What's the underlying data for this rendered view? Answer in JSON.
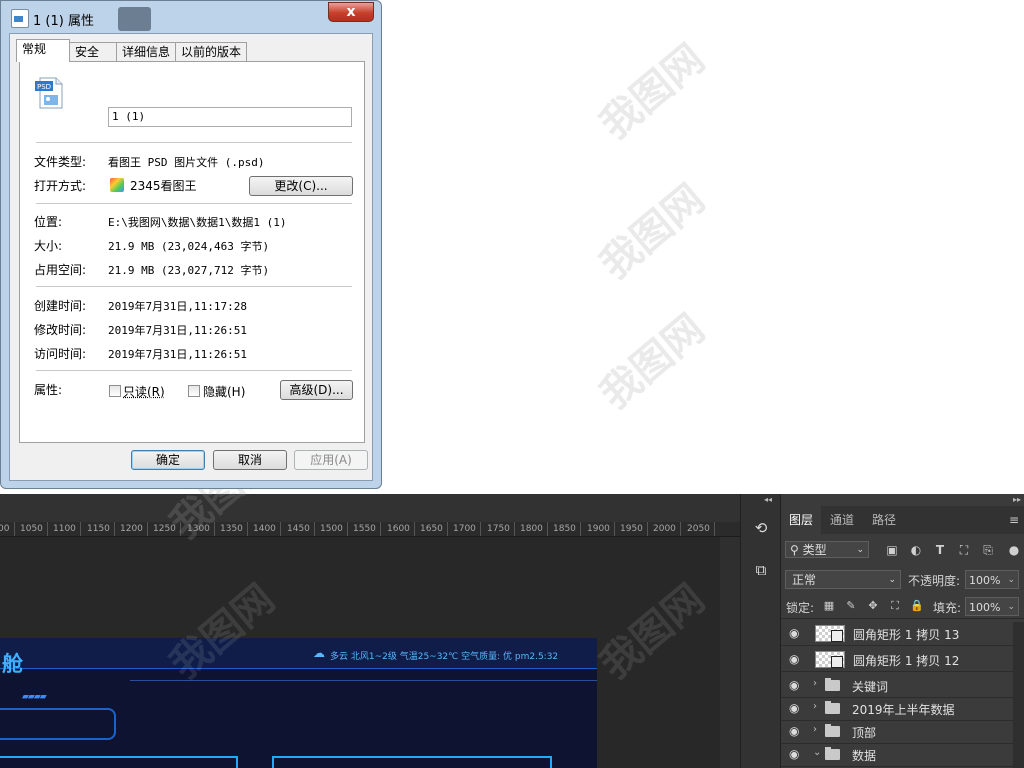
{
  "dialog": {
    "title": "1 (1) 属性",
    "close_label": "x",
    "tabs": [
      "常规",
      "安全",
      "详细信息",
      "以前的版本"
    ],
    "file_name": "1 (1)",
    "psd_badge": "PSD",
    "file_type_label": "文件类型:",
    "file_type_value": "看图王 PSD 图片文件 (.psd)",
    "open_with_label": "打开方式:",
    "open_with_value": "2345看图王",
    "change_button": "更改(C)...",
    "location_label": "位置:",
    "location_value": "E:\\我图网\\数据\\数据1\\数据1 (1)",
    "size_label": "大小:",
    "size_value": "21.9 MB (23,024,463 字节)",
    "disk_size_label": "占用空间:",
    "disk_size_value": "21.9 MB (23,027,712 字节)",
    "created_label": "创建时间:",
    "created_value": "2019年7月31日,11:17:28",
    "modified_label": "修改时间:",
    "modified_value": "2019年7月31日,11:26:51",
    "accessed_label": "访问时间:",
    "accessed_value": "2019年7月31日,11:26:51",
    "attributes_label": "属性:",
    "readonly_label": "只读(R)",
    "hidden_label": "隐藏(H)",
    "advanced_button": "高级(D)...",
    "ok_button": "确定",
    "cancel_button": "取消",
    "apply_button": "应用(A)"
  },
  "photoshop": {
    "ruler_labels": [
      "00",
      "1050",
      "1100",
      "1150",
      "1200",
      "1250",
      "1300",
      "1350",
      "1400",
      "1450",
      "1500",
      "1550",
      "1600",
      "1650",
      "1700",
      "1750",
      "1800",
      "1850",
      "1900",
      "1950",
      "2000",
      "2050"
    ],
    "artwork": {
      "title": "舱",
      "weather": "多云  北风1~2级  气温25~32℃  空气质量: 优  pm2.5:32",
      "stripes": "▰▰▰▰"
    },
    "layers_panel": {
      "tabs": [
        "图层",
        "通道",
        "路径"
      ],
      "kind_filter": "类型",
      "blend_mode": "正常",
      "opacity_label": "不透明度:",
      "opacity_value": "100%",
      "lock_label": "锁定:",
      "fill_label": "填充:",
      "fill_value": "100%",
      "layers": [
        {
          "name": "圆角矩形 1 拷贝 13",
          "type": "shape"
        },
        {
          "name": "圆角矩形 1 拷贝 12",
          "type": "shape"
        },
        {
          "name": "关键词",
          "type": "group",
          "expanded": false
        },
        {
          "name": "2019年上半年数据",
          "type": "group",
          "expanded": false
        },
        {
          "name": "顶部",
          "type": "group",
          "expanded": false
        },
        {
          "name": "数据",
          "type": "group",
          "expanded": true
        }
      ]
    }
  },
  "watermark": "我图网",
  "accent_colors": {
    "artwork_blue": "#3fb0ff",
    "ps_panel": "#3b3b3b",
    "dialog_frame": "#bdd3ea"
  }
}
